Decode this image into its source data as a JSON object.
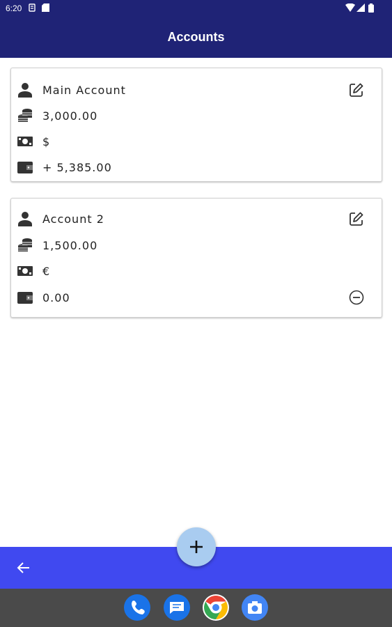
{
  "status_bar": {
    "time": "6:20"
  },
  "app_bar": {
    "title": "Accounts"
  },
  "accounts": [
    {
      "name": "Main Account",
      "balance": "3,000.00",
      "currency": "$",
      "total": "+ 5,385.00"
    },
    {
      "name": "Account 2",
      "balance": "1,500.00",
      "currency": "€",
      "total": "0.00"
    }
  ],
  "fab": {
    "label": "+"
  },
  "colors": {
    "app_bar": "#1f2376",
    "bottom_bar": "#4049f0",
    "fab": "#a9ccf0",
    "nav_bar": "#4a4a4a"
  },
  "dock": [
    "phone-icon",
    "messages-icon",
    "chrome-icon",
    "camera-icon"
  ]
}
